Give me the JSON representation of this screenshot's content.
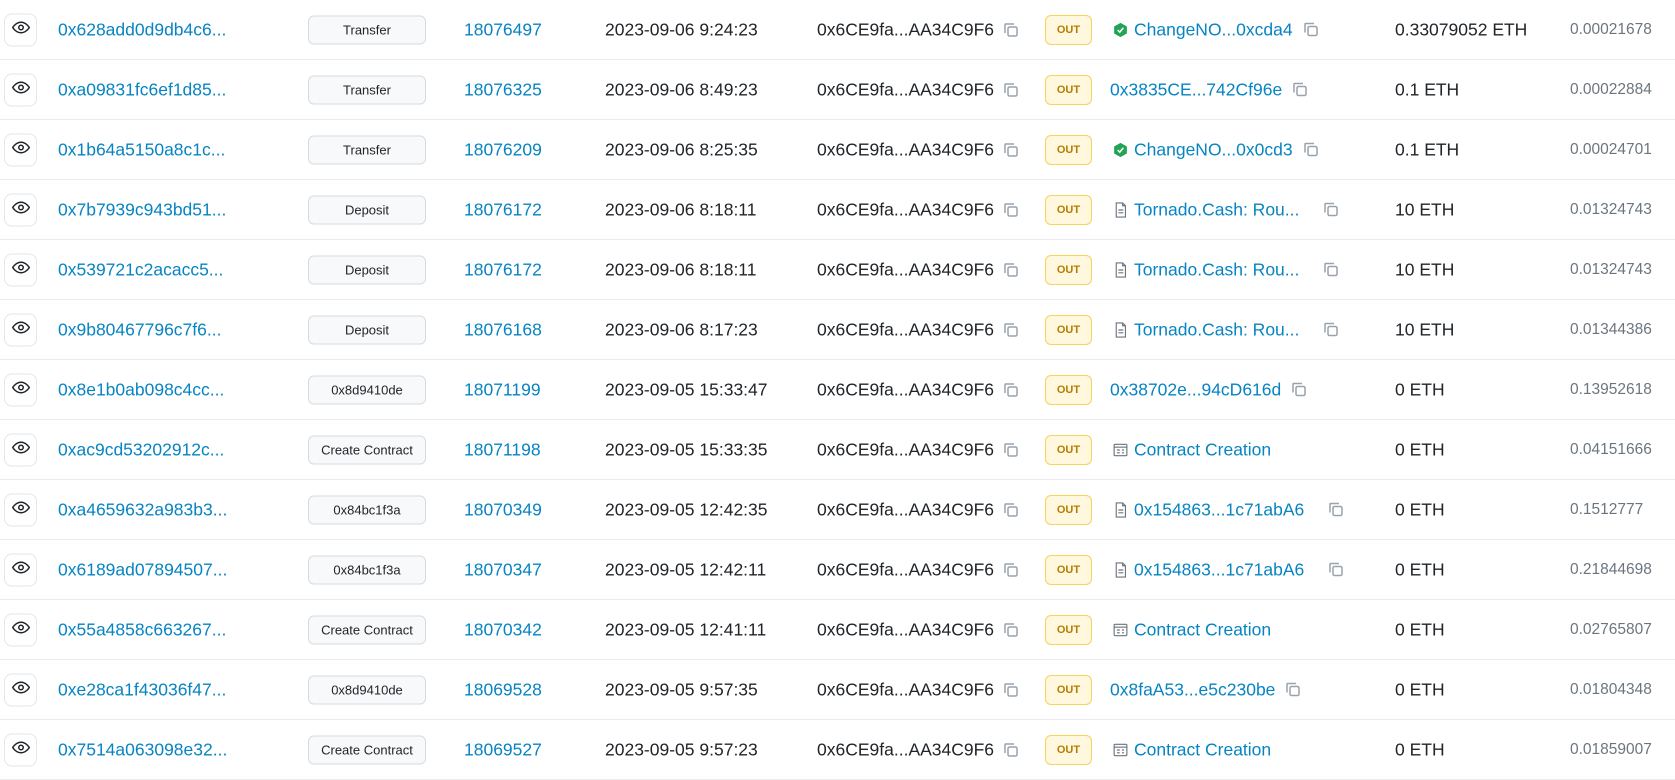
{
  "transactions": [
    {
      "hash": "0x628add0d9db4c6...",
      "method": "Transfer",
      "block": "18076497",
      "age": "2023-09-06 9:24:23",
      "from": "0x6CE9fa...AA34C9F6",
      "direction": "OUT",
      "to": "ChangeNO...0xcda4",
      "to_icon": "verified-icon",
      "amount": "0.33079052 ETH",
      "fee": "0.00021678"
    },
    {
      "hash": "0xa09831fc6ef1d85...",
      "method": "Transfer",
      "block": "18076325",
      "age": "2023-09-06 8:49:23",
      "from": "0x6CE9fa...AA34C9F6",
      "direction": "OUT",
      "to": "0x3835CE...742Cf96e",
      "to_icon": "",
      "amount": "0.1 ETH",
      "fee": "0.00022884"
    },
    {
      "hash": "0x1b64a5150a8c1c...",
      "method": "Transfer",
      "block": "18076209",
      "age": "2023-09-06 8:25:35",
      "from": "0x6CE9fa...AA34C9F6",
      "direction": "OUT",
      "to": "ChangeNO...0x0cd3",
      "to_icon": "verified-icon",
      "amount": "0.1 ETH",
      "fee": "0.00024701"
    },
    {
      "hash": "0x7b7939c943bd51...",
      "method": "Deposit",
      "block": "18076172",
      "age": "2023-09-06 8:18:11",
      "from": "0x6CE9fa...AA34C9F6",
      "direction": "OUT",
      "to": "Tornado.Cash: Rou...",
      "to_icon": "contract-icon",
      "amount": "10 ETH",
      "fee": "0.01324743"
    },
    {
      "hash": "0x539721c2acacc5...",
      "method": "Deposit",
      "block": "18076172",
      "age": "2023-09-06 8:18:11",
      "from": "0x6CE9fa...AA34C9F6",
      "direction": "OUT",
      "to": "Tornado.Cash: Rou...",
      "to_icon": "contract-icon",
      "amount": "10 ETH",
      "fee": "0.01324743"
    },
    {
      "hash": "0x9b80467796c7f6...",
      "method": "Deposit",
      "block": "18076168",
      "age": "2023-09-06 8:17:23",
      "from": "0x6CE9fa...AA34C9F6",
      "direction": "OUT",
      "to": "Tornado.Cash: Rou...",
      "to_icon": "contract-icon",
      "amount": "10 ETH",
      "fee": "0.01344386"
    },
    {
      "hash": "0x8e1b0ab098c4cc...",
      "method": "0x8d9410de",
      "block": "18071199",
      "age": "2023-09-05 15:33:47",
      "from": "0x6CE9fa...AA34C9F6",
      "direction": "OUT",
      "to": "0x38702e...94cD616d",
      "to_icon": "",
      "amount": "0 ETH",
      "fee": "0.13952618"
    },
    {
      "hash": "0xac9cd53202912c...",
      "method": "Create Contract",
      "block": "18071198",
      "age": "2023-09-05 15:33:35",
      "from": "0x6CE9fa...AA34C9F6",
      "direction": "OUT",
      "to": "Contract Creation",
      "to_icon": "contract-creation-icon",
      "amount": "0 ETH",
      "fee": "0.04151666"
    },
    {
      "hash": "0xa4659632a983b3...",
      "method": "0x84bc1f3a",
      "block": "18070349",
      "age": "2023-09-05 12:42:35",
      "from": "0x6CE9fa...AA34C9F6",
      "direction": "OUT",
      "to": "0x154863...1c71abA6",
      "to_icon": "contract-icon",
      "amount": "0 ETH",
      "fee": "0.1512777"
    },
    {
      "hash": "0x6189ad07894507...",
      "method": "0x84bc1f3a",
      "block": "18070347",
      "age": "2023-09-05 12:42:11",
      "from": "0x6CE9fa...AA34C9F6",
      "direction": "OUT",
      "to": "0x154863...1c71abA6",
      "to_icon": "contract-icon",
      "amount": "0 ETH",
      "fee": "0.21844698"
    },
    {
      "hash": "0x55a4858c663267...",
      "method": "Create Contract",
      "block": "18070342",
      "age": "2023-09-05 12:41:11",
      "from": "0x6CE9fa...AA34C9F6",
      "direction": "OUT",
      "to": "Contract Creation",
      "to_icon": "contract-creation-icon",
      "amount": "0 ETH",
      "fee": "0.02765807"
    },
    {
      "hash": "0xe28ca1f43036f47...",
      "method": "0x8d9410de",
      "block": "18069528",
      "age": "2023-09-05 9:57:35",
      "from": "0x6CE9fa...AA34C9F6",
      "direction": "OUT",
      "to": "0x8faA53...e5c230be",
      "to_icon": "",
      "amount": "0 ETH",
      "fee": "0.01804348"
    },
    {
      "hash": "0x7514a063098e32...",
      "method": "Create Contract",
      "block": "18069527",
      "age": "2023-09-05 9:57:23",
      "from": "0x6CE9fa...AA34C9F6",
      "direction": "OUT",
      "to": "Contract Creation",
      "to_icon": "contract-creation-icon",
      "amount": "0 ETH",
      "fee": "0.01859007"
    }
  ],
  "colors": {
    "link": "#0784c3",
    "out_badge_bg": "#fff7de",
    "out_badge_text": "#b47d00",
    "verified_green": "#23a455"
  }
}
